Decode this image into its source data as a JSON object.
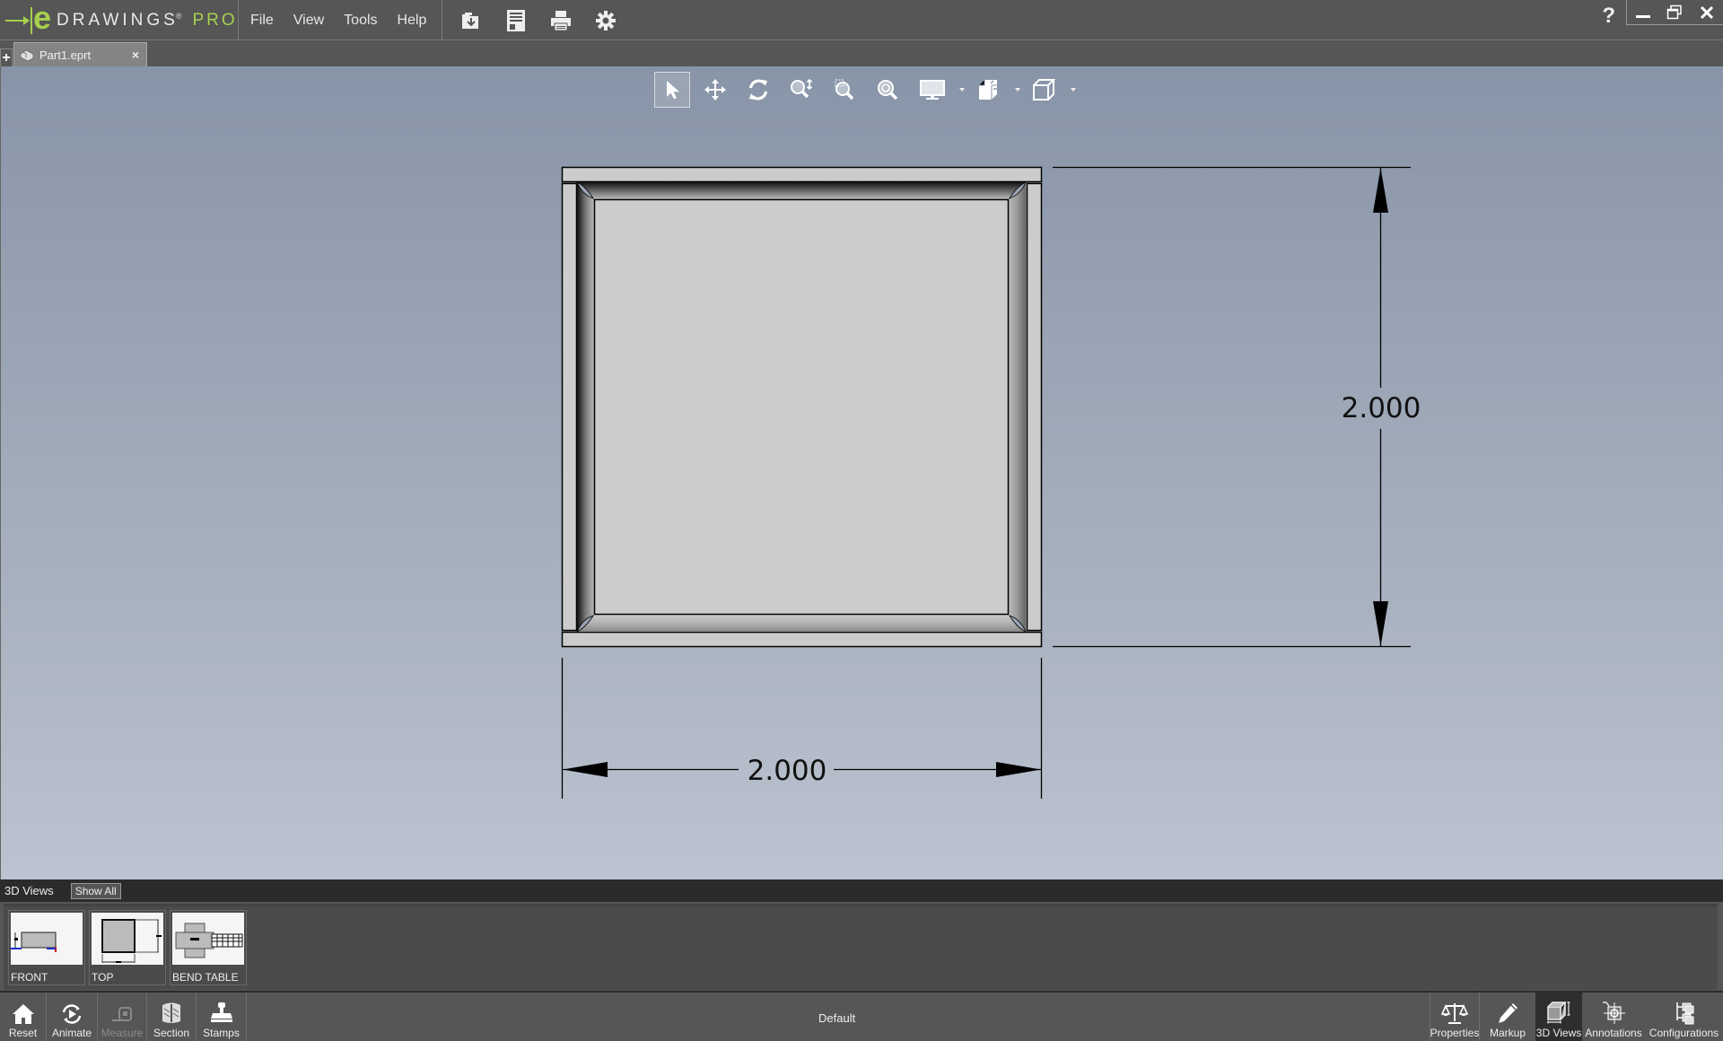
{
  "app": {
    "brand_e": "e",
    "brand_word": "DRAWINGS",
    "brand_reg": "®",
    "brand_pro": "PRO",
    "menus": [
      "File",
      "View",
      "Tools",
      "Help"
    ],
    "quick_actions": [
      {
        "name": "open",
        "icon": "open-folder-icon"
      },
      {
        "name": "save",
        "icon": "save-icon"
      },
      {
        "name": "print",
        "icon": "print-icon"
      },
      {
        "name": "settings",
        "icon": "gear-icon"
      }
    ],
    "help_label": "?",
    "window_controls": [
      "minimize",
      "restore",
      "close"
    ]
  },
  "tabs": {
    "new_tab_label": "+",
    "items": [
      {
        "label": "Part1.eprt",
        "close": "×",
        "active": true
      }
    ]
  },
  "view_toolbar": {
    "tools": [
      {
        "name": "select",
        "icon": "arrow-pointer-icon",
        "selected": true
      },
      {
        "name": "pan",
        "icon": "move-arrows-icon"
      },
      {
        "name": "rotate",
        "icon": "rotate-icon"
      },
      {
        "name": "zoom",
        "icon": "zoom-updown-icon"
      },
      {
        "name": "zoom-to-area",
        "icon": "zoom-area-icon"
      },
      {
        "name": "zoom-to-fit",
        "icon": "zoom-fit-icon"
      },
      {
        "name": "display-style",
        "icon": "monitor-icon",
        "dropdown": true
      },
      {
        "name": "views",
        "icon": "view-orient-icon",
        "dropdown": true
      },
      {
        "name": "standard-views",
        "icon": "cube-icon",
        "dropdown": true
      }
    ]
  },
  "drawing": {
    "horizontal_dimension": "2.000",
    "vertical_dimension": "2.000",
    "face_color": "#cccccc",
    "line_color": "#000000"
  },
  "views_panel": {
    "title": "3D Views",
    "show_all_label": "Show All",
    "thumbnails": [
      {
        "label": "FRONT"
      },
      {
        "label": "TOP"
      },
      {
        "label": "BEND TABLE"
      }
    ]
  },
  "bottom_bar": {
    "left_tools": [
      {
        "label": "Reset",
        "icon": "home-icon",
        "enabled": true
      },
      {
        "label": "Animate",
        "icon": "animate-icon",
        "enabled": true
      },
      {
        "label": "Measure",
        "icon": "tape-measure-icon",
        "enabled": false
      },
      {
        "label": "Section",
        "icon": "section-icon",
        "enabled": true
      },
      {
        "label": "Stamps",
        "icon": "stamp-icon",
        "enabled": true
      }
    ],
    "configuration": "Default",
    "right_tools": [
      {
        "label": "Properties",
        "icon": "scale-balance-icon",
        "active": false
      },
      {
        "label": "Markup",
        "icon": "pencil-icon",
        "active": false
      },
      {
        "label": "3D Views",
        "icon": "3d-views-icon",
        "active": true
      },
      {
        "label": "Annotations",
        "icon": "annotation-icon",
        "active": false
      },
      {
        "label": "Configurations",
        "icon": "configurations-icon",
        "active": false
      }
    ]
  },
  "colors": {
    "brand_green": "#a6d04f",
    "chrome_gray": "#555655",
    "panel_dark": "#2b2b2b"
  }
}
